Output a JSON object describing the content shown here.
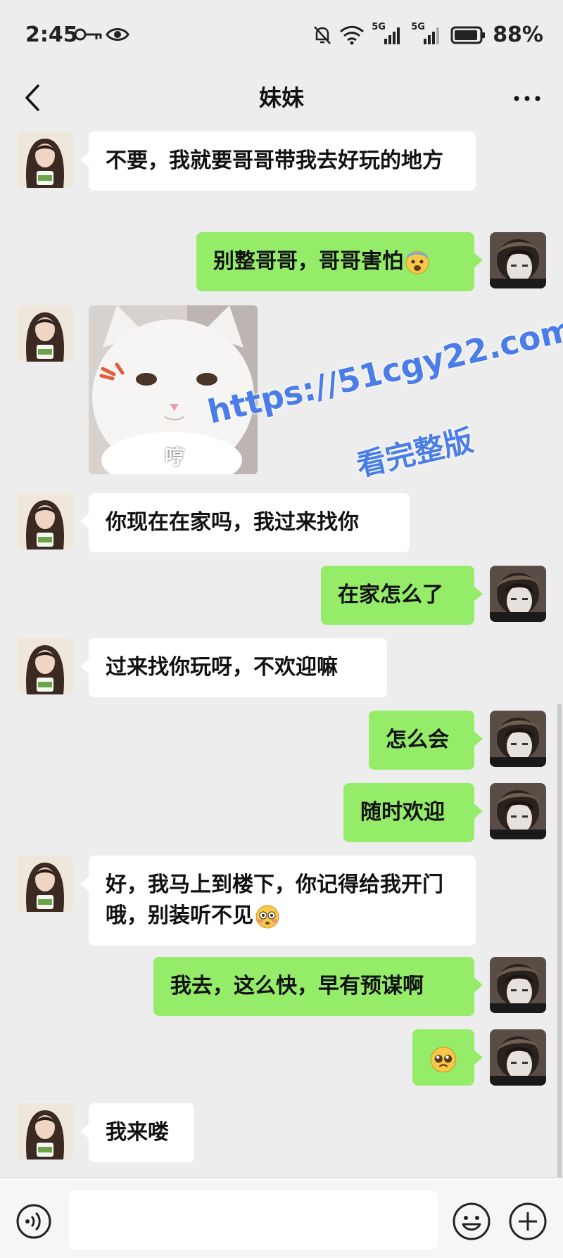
{
  "status_bar": {
    "time": "2:45",
    "battery": "88%",
    "network_1": "5G",
    "network_2": "5G"
  },
  "nav": {
    "title": "妹妹"
  },
  "messages": [
    {
      "side": "in",
      "type": "text",
      "text": "不要，我就要哥哥带我去好玩的地方"
    },
    {
      "side": "out",
      "type": "text",
      "text": "别整哥哥，哥哥害怕",
      "emoji": "fearful-face"
    },
    {
      "side": "in",
      "type": "sticker",
      "caption": "哼",
      "sticker": "angry-white-cat"
    },
    {
      "side": "in",
      "type": "text",
      "text": "你现在在家吗，我过来找你"
    },
    {
      "side": "out",
      "type": "text",
      "text": "在家怎么了"
    },
    {
      "side": "in",
      "type": "text",
      "text": "过来找你玩呀，不欢迎嘛"
    },
    {
      "side": "out",
      "type": "text",
      "text": "怎么会"
    },
    {
      "side": "out",
      "type": "text",
      "text": "随时欢迎"
    },
    {
      "side": "in",
      "type": "text",
      "text": "好，我马上到楼下，你记得给我开门哦，别装听不见",
      "emoji": "flushed-face"
    },
    {
      "side": "out",
      "type": "text",
      "text": "我去，这么快，早有预谋啊"
    },
    {
      "side": "out",
      "type": "emoji",
      "emoji": "pleading-face"
    },
    {
      "side": "in",
      "type": "text",
      "text": "我来喽"
    }
  ],
  "watermark": {
    "line1": "https://51cgy22.com",
    "line2": "看完整版"
  },
  "icons": {
    "back": "chevron-left-icon",
    "more": "more-dots-icon",
    "voice": "voice-icon",
    "emoji": "emoji-icon",
    "plus": "plus-icon"
  },
  "colors": {
    "background": "#ededed",
    "outgoing_bubble": "#95ec69",
    "incoming_bubble": "#ffffff",
    "watermark": "#4a7de8"
  }
}
